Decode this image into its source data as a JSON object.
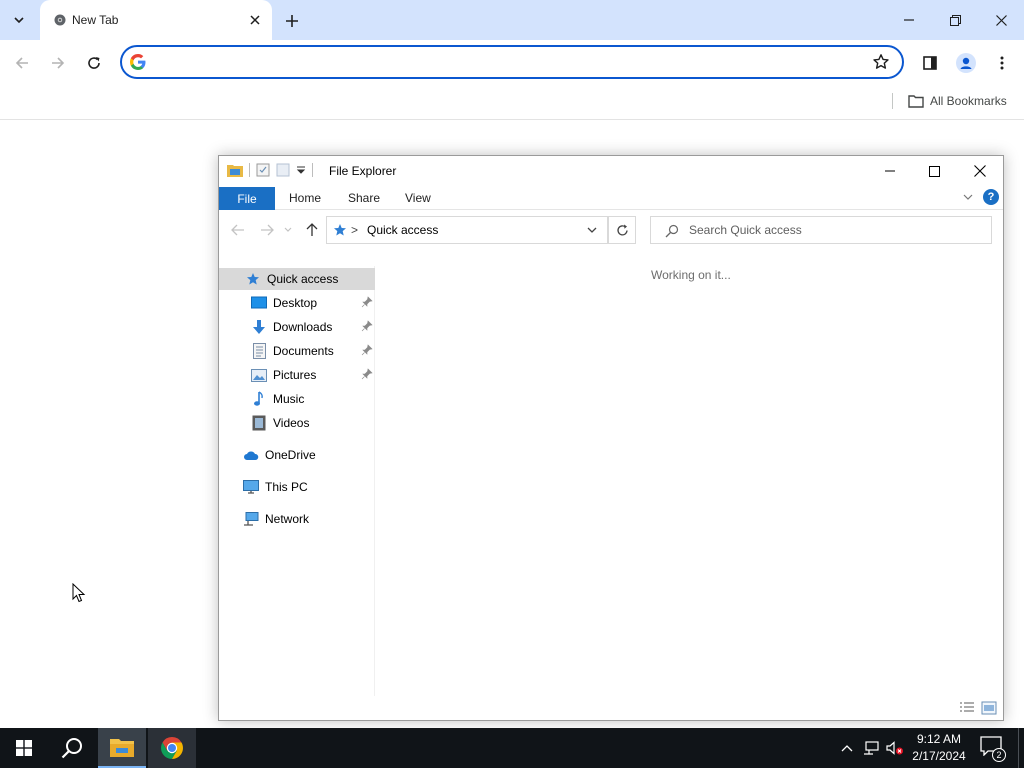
{
  "browser": {
    "tab": {
      "title": "New Tab"
    },
    "omnibox": {
      "value": "",
      "placeholder": ""
    },
    "bookmarks_bar": {
      "all_bookmarks_label": "All Bookmarks"
    }
  },
  "explorer": {
    "title": "File Explorer",
    "ribbon": {
      "file": "File",
      "home": "Home",
      "share": "Share",
      "view": "View",
      "help": "?"
    },
    "address": {
      "separator": ">",
      "location": "Quick access"
    },
    "search": {
      "placeholder": "Search Quick access",
      "value": ""
    },
    "nav": {
      "quick_access": "Quick access",
      "desktop": "Desktop",
      "downloads": "Downloads",
      "documents": "Documents",
      "pictures": "Pictures",
      "music": "Music",
      "videos": "Videos",
      "onedrive": "OneDrive",
      "this_pc": "This PC",
      "network": "Network"
    },
    "content": {
      "status_text": "Working on it..."
    }
  },
  "taskbar": {
    "clock": {
      "time": "9:12 AM",
      "date": "2/17/2024"
    },
    "notification_count": "2"
  },
  "colors": {
    "tab_strip": "#d3e3fd",
    "omnibox_focus": "#0b57d0",
    "file_tab": "#1a6fc4",
    "taskbar": "#101418",
    "nav_selected": "#d9d9d9"
  }
}
